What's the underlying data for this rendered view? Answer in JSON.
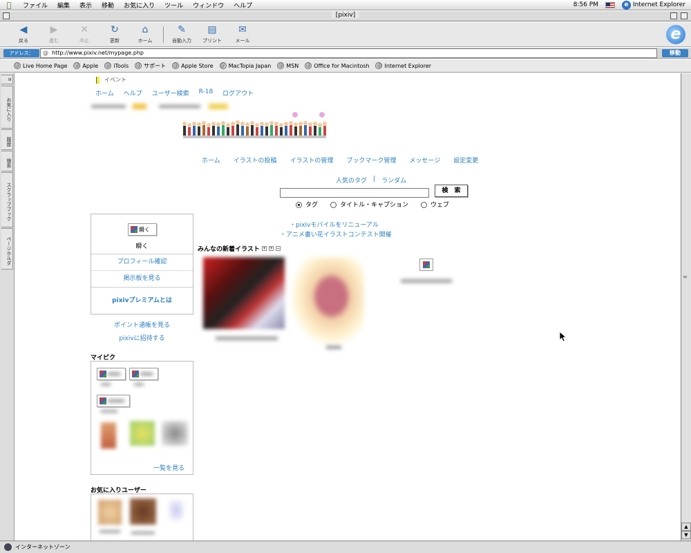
{
  "menubar": {
    "items": [
      "ファイル",
      "編集",
      "表示",
      "移動",
      "お気に入り",
      "ツール",
      "ウィンドウ",
      "ヘルプ"
    ],
    "clock": "8:56 PM",
    "app_name": "Internet Explorer"
  },
  "window": {
    "title": "[pixiv]"
  },
  "toolbar": {
    "back": "戻る",
    "forward": "進む",
    "stop": "中止",
    "refresh": "更新",
    "home": "ホーム",
    "autofill": "自動入力",
    "print": "プリント",
    "mail": "メール"
  },
  "address": {
    "label": "アドレス：",
    "url": "http://www.pixiv.net/mypage.php",
    "go": "移動"
  },
  "favorites": [
    "Live Home Page",
    "Apple",
    "iTools",
    "サポート",
    "Apple Store",
    "MacTopia Japan",
    "MSN",
    "Office for Macintosh",
    "Internet Explorer"
  ],
  "sidetabs": [
    "お気に入り",
    "履歴",
    "検索",
    "スクラップブック",
    "ページホルダ"
  ],
  "page": {
    "event": "イベント",
    "topnav": [
      "ホーム",
      "ヘルプ",
      "ユーザー検索",
      "R-18",
      "ログアウト"
    ],
    "mainnav": [
      "ホーム",
      "イラストの投稿",
      "イラストの管理",
      "ブックマーク管理",
      "メッセージ",
      "設定変更"
    ],
    "taglinks": [
      "人気のタグ",
      "|",
      "ランダム"
    ],
    "search_button": "検　索",
    "search_value": "",
    "radios": [
      "タグ",
      "タイトル・キャプション",
      "ウェブ"
    ],
    "profile": {
      "avatar_alt": "瞬く",
      "name": "瞬く",
      "links": [
        "プロフィール確認",
        "掲示板を見る"
      ],
      "premium": "pixivプレミアムとは"
    },
    "point_links": [
      "ポイント通帳を見る",
      "pixivに招待する"
    ],
    "news": [
      "・pixivモバイルをリニューアル",
      "・アニメ書い花イラストコンテスト開催"
    ],
    "new_illust_title": "みんなの新着イラスト",
    "mypic_title": "マイピク",
    "mypic_more": "一覧を見る",
    "favusers_title": "お気に入りユーザー"
  },
  "status": {
    "text": "インターネットゾーン"
  }
}
